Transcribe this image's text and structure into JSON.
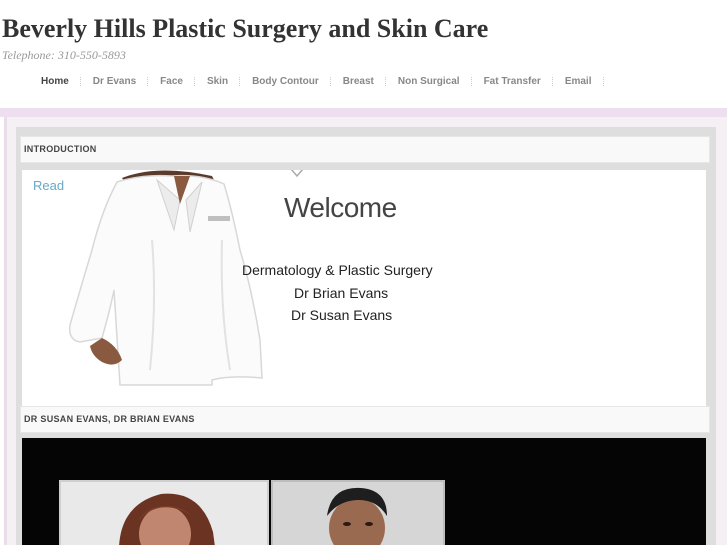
{
  "site": {
    "title": "Beverly Hills Plastic Surgery and Skin Care",
    "phone": "Telephone: 310-550-5893"
  },
  "nav": {
    "items": [
      "Home",
      "Dr Evans",
      "Face",
      "Skin",
      "Body Contour",
      "Breast",
      "Non Surgical",
      "Fat Transfer",
      "Email"
    ],
    "active": "Home"
  },
  "sections": {
    "intro_heading": "INTRODUCTION",
    "read_link": "Read",
    "doctors_heading": "DR SUSAN EVANS, DR BRIAN EVANS"
  },
  "welcome_banner": {
    "heading": "Welcome",
    "line1": "Dermatology & Plastic Surgery",
    "line2": "Dr Brian Evans",
    "line3": "Dr Susan Evans"
  },
  "colors": {
    "accent_link": "#6aa7c7",
    "band": "#eedff0"
  }
}
